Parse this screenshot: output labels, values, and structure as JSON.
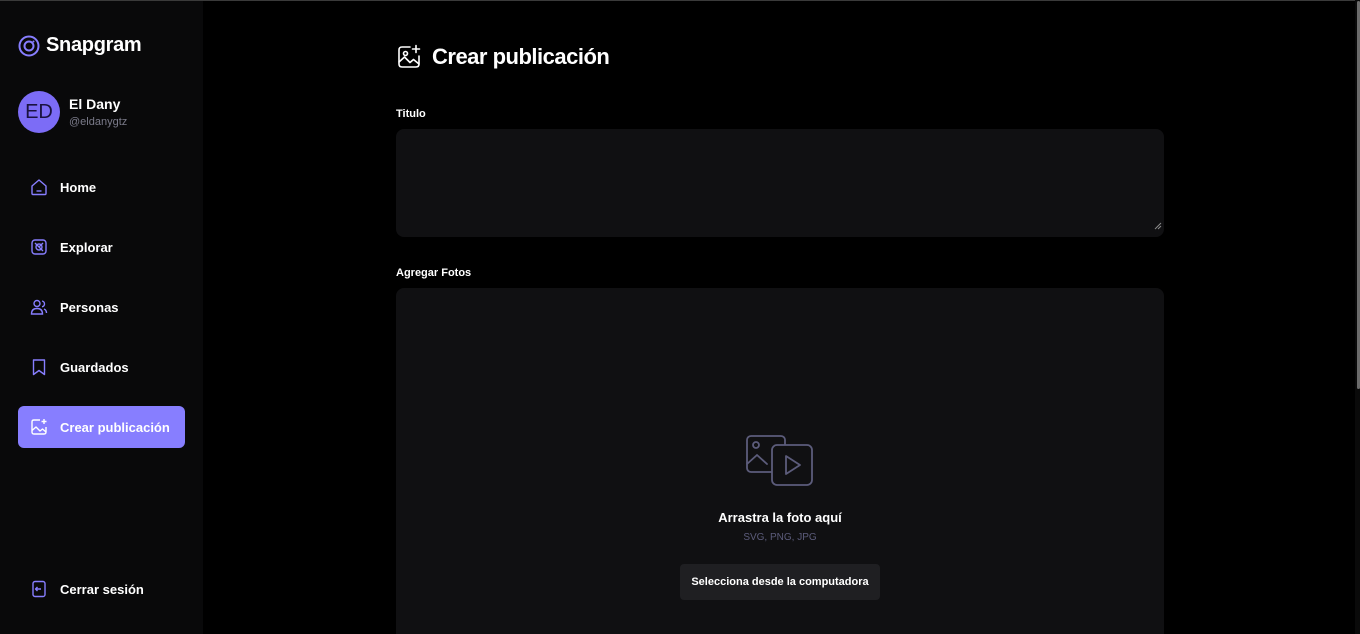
{
  "app": {
    "name": "Snapgram"
  },
  "profile": {
    "initials": "ED",
    "name": "El Dany",
    "handle": "@eldanygtz"
  },
  "sidebar": {
    "items": [
      {
        "label": "Home",
        "icon": "home-icon"
      },
      {
        "label": "Explorar",
        "icon": "explore-icon"
      },
      {
        "label": "Personas",
        "icon": "people-icon"
      },
      {
        "label": "Guardados",
        "icon": "bookmark-icon"
      },
      {
        "label": "Crear publicación",
        "icon": "create-post-icon",
        "active": true
      }
    ],
    "logout_label": "Cerrar sesión"
  },
  "page": {
    "title": "Crear publicación",
    "title_label": "Titulo",
    "photos_label": "Agregar Fotos",
    "dropzone": {
      "title": "Arrastra la foto aquí",
      "formats": "SVG, PNG, JPG",
      "button_label": "Selecciona desde la computadora"
    }
  },
  "colors": {
    "accent": "#877eff",
    "background": "#000000",
    "sidebar": "#09090a",
    "input": "#101012",
    "muted": "#5c5c7b"
  }
}
